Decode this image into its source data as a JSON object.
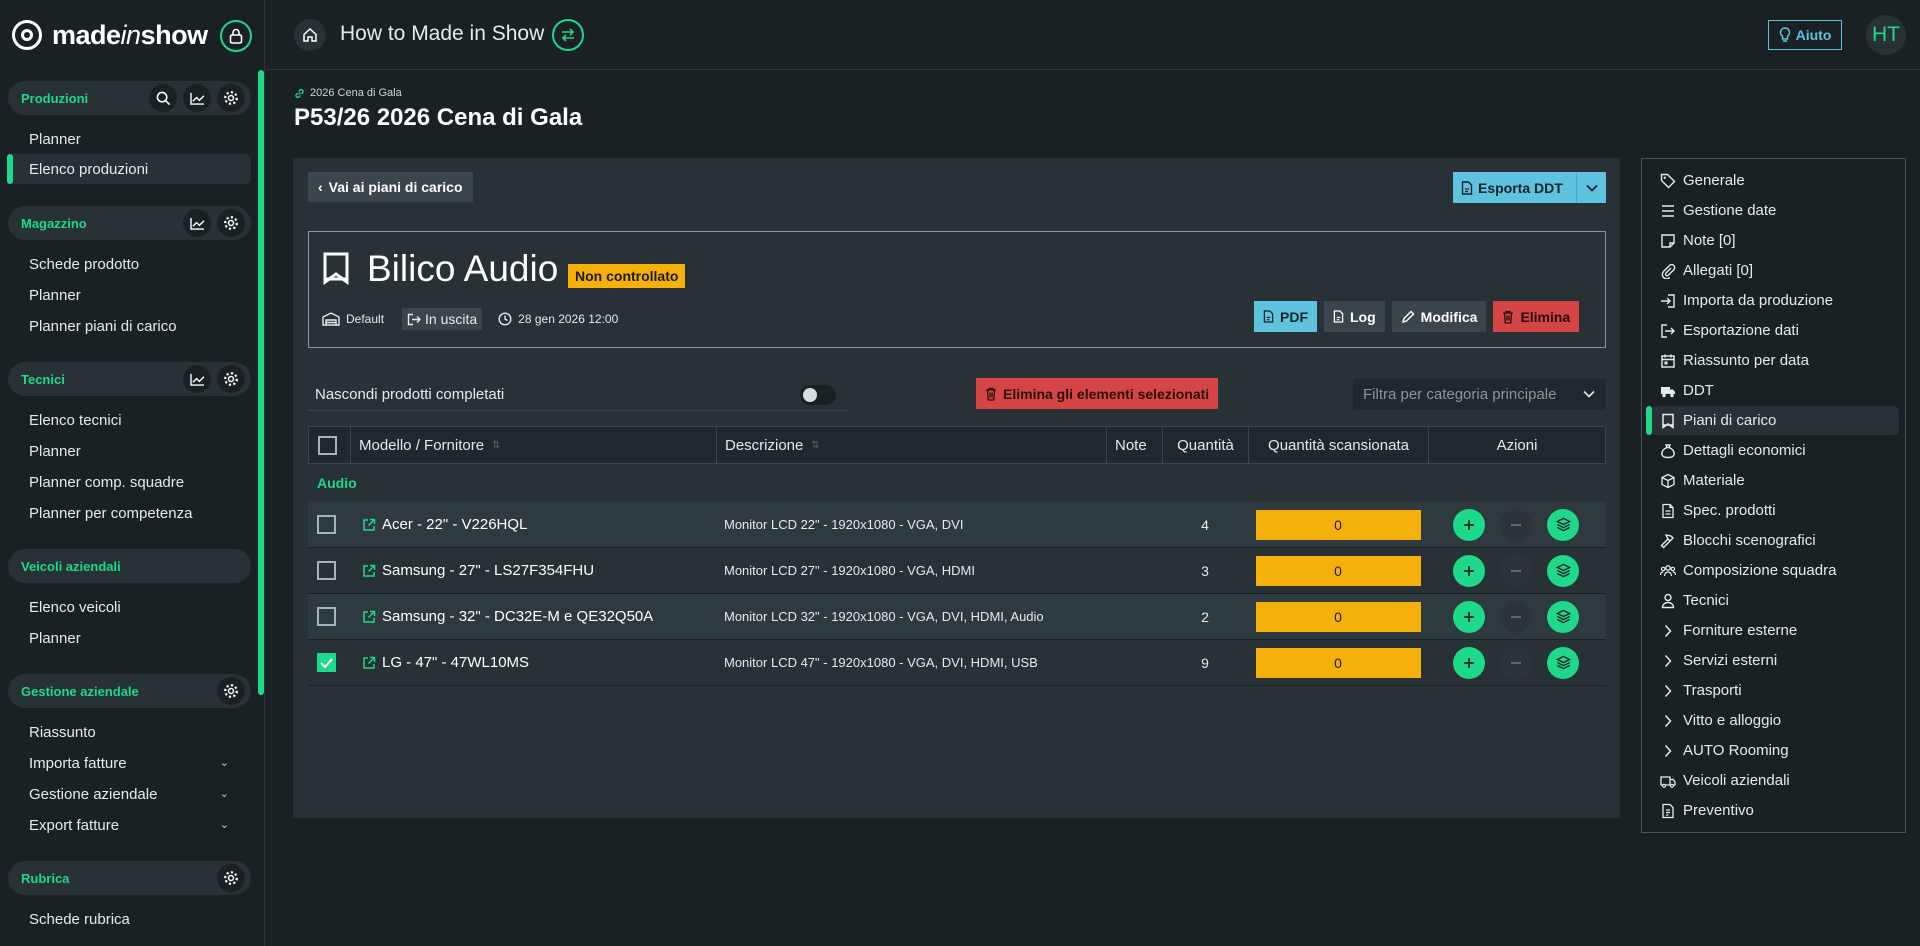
{
  "brand": {
    "logo_pre": "made",
    "logo_mid": "in",
    "logo_post": "show"
  },
  "sidebar": {
    "sections": [
      {
        "title": "Produzioni",
        "items": [
          "Planner",
          "Elenco produzioni"
        ]
      },
      {
        "title": "Magazzino",
        "items": [
          "Schede prodotto",
          "Planner",
          "Planner piani di carico"
        ]
      },
      {
        "title": "Tecnici",
        "items": [
          "Elenco tecnici",
          "Planner",
          "Planner comp. squadre",
          "Planner per competenza"
        ]
      },
      {
        "title": "Veicoli aziendali",
        "items": [
          "Elenco veicoli",
          "Planner"
        ]
      },
      {
        "title": "Gestione aziendale",
        "items": [
          "Riassunto",
          "Importa fatture",
          "Gestione aziendale",
          "Export fatture"
        ]
      },
      {
        "title": "Rubrica",
        "items": [
          "Schede rubrica"
        ]
      }
    ]
  },
  "header": {
    "title": "How to Made in Show",
    "help_label": "Aiuto",
    "avatar_initials": "HT"
  },
  "page": {
    "breadcrumb": "2026 Cena di Gala",
    "title": "P53/26 2026 Cena di Gala"
  },
  "toolbar": {
    "back_label": "Vai ai piani di carico",
    "export_label": "Esporta DDT"
  },
  "card": {
    "title": "Bilico Audio",
    "status_badge": "Non controllato",
    "warehouse": "Default",
    "direction": "In uscita",
    "datetime": "28 gen 2026 12:00",
    "actions": {
      "pdf": "PDF",
      "log": "Log",
      "edit": "Modifica",
      "delete": "Elimina"
    }
  },
  "controls": {
    "hide_completed_label": "Nascondi prodotti completati",
    "delete_selected_label": "Elimina gli elementi selezionati",
    "filter_placeholder": "Filtra per categoria principale"
  },
  "table": {
    "headers": {
      "model": "Modello / Fornitore",
      "description": "Descrizione",
      "notes": "Note",
      "quantity": "Quantità",
      "scanned": "Quantità scansionata",
      "actions": "Azioni"
    },
    "group": "Audio",
    "rows": [
      {
        "model": "Acer - 22\" - V226HQL",
        "description": "Monitor LCD 22\" - 1920x1080 - VGA, DVI",
        "quantity": "4",
        "scanned": "0",
        "checked": false
      },
      {
        "model": "Samsung - 27\" - LS27F354FHU",
        "description": "Monitor LCD 27\" - 1920x1080 - VGA, HDMI",
        "quantity": "3",
        "scanned": "0",
        "checked": false
      },
      {
        "model": "Samsung - 32\" - DC32E-M e QE32Q50A",
        "description": "Monitor LCD 32\" - 1920x1080 - VGA, DVI, HDMI, Audio",
        "quantity": "2",
        "scanned": "0",
        "checked": false
      },
      {
        "model": "LG - 47\" - 47WL10MS",
        "description": "Monitor LCD 47\" - 1920x1080 - VGA, DVI, HDMI, USB",
        "quantity": "9",
        "scanned": "0",
        "checked": true
      }
    ]
  },
  "right_nav": {
    "items": [
      {
        "label": "Generale",
        "icon": "tag-icon"
      },
      {
        "label": "Gestione date",
        "icon": "list-icon"
      },
      {
        "label": "Note [0]",
        "icon": "note-icon"
      },
      {
        "label": "Allegati [0]",
        "icon": "paperclip-icon"
      },
      {
        "label": "Importa da produzione",
        "icon": "import-icon"
      },
      {
        "label": "Esportazione dati",
        "icon": "export-icon"
      },
      {
        "label": "Riassunto per data",
        "icon": "calendar-icon"
      },
      {
        "label": "DDT",
        "icon": "truck-icon"
      },
      {
        "label": "Piani di carico",
        "icon": "bookmark-icon"
      },
      {
        "label": "Dettagli economici",
        "icon": "money-bag-icon"
      },
      {
        "label": "Materiale",
        "icon": "box-icon"
      },
      {
        "label": "Spec. prodotti",
        "icon": "document-icon"
      },
      {
        "label": "Blocchi scenografici",
        "icon": "hammer-icon"
      },
      {
        "label": "Composizione squadra",
        "icon": "team-icon"
      },
      {
        "label": "Tecnici",
        "icon": "user-icon"
      },
      {
        "label": "Forniture esterne",
        "icon": "chevron-right-icon"
      },
      {
        "label": "Servizi esterni",
        "icon": "chevron-right-icon"
      },
      {
        "label": "Trasporti",
        "icon": "chevron-right-icon"
      },
      {
        "label": "Vitto e alloggio",
        "icon": "chevron-right-icon"
      },
      {
        "label": "AUTO Rooming",
        "icon": "chevron-right-icon"
      },
      {
        "label": "Veicoli aziendali",
        "icon": "van-icon"
      },
      {
        "label": "Preventivo",
        "icon": "invoice-icon"
      }
    ]
  },
  "colors": {
    "accent": "#1ed98a",
    "info": "#5fc3e0",
    "warning": "#f5b10a",
    "danger": "#d64545"
  }
}
